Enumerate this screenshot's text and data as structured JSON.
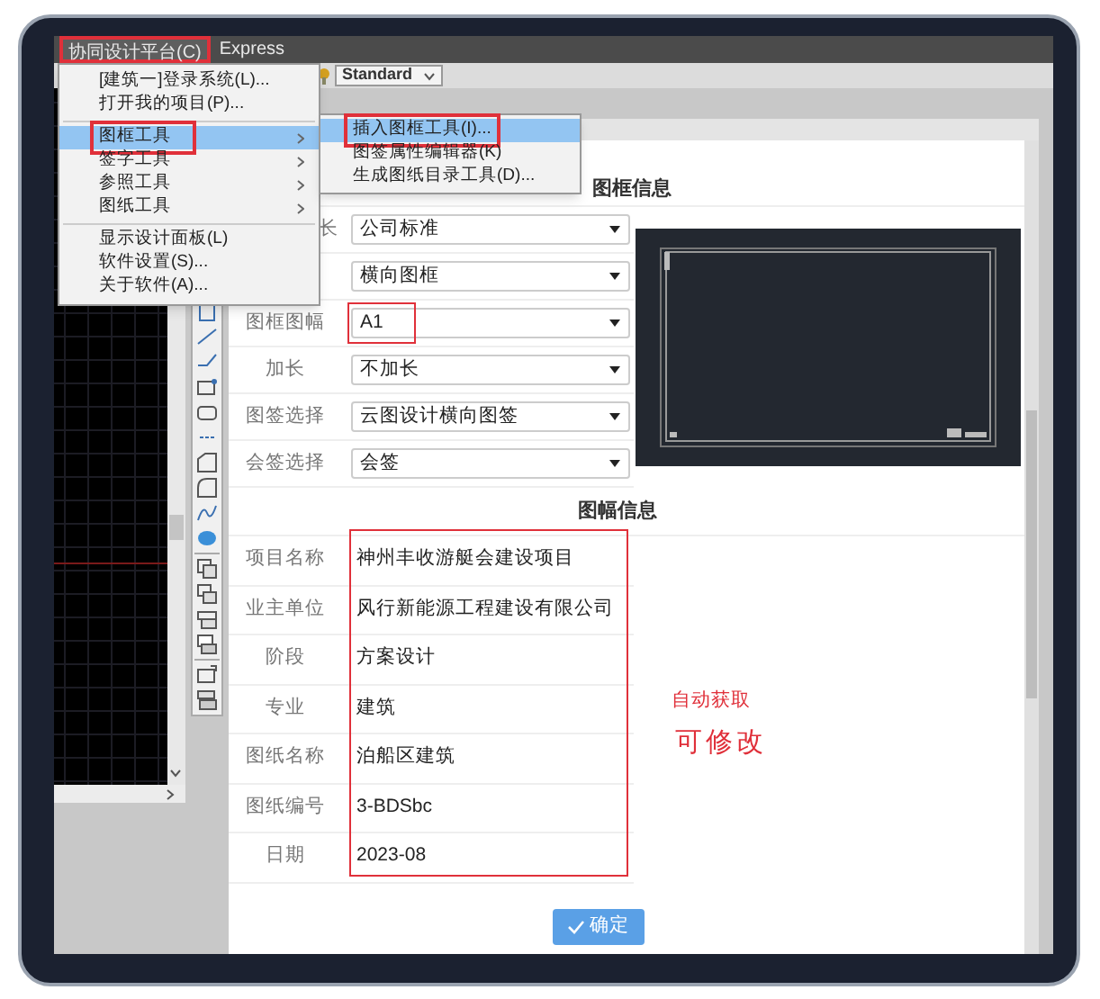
{
  "menubar": [
    {
      "label": "协同设计平台(C)",
      "highlighted": true
    },
    {
      "label": "Express",
      "highlighted": false
    }
  ],
  "toolbar": {
    "style_dropdown": "Standard"
  },
  "menu": [
    {
      "kind": "item",
      "label": "[建筑一]登录系统(L)...",
      "submenu": false,
      "selected": false,
      "highlighted": false
    },
    {
      "kind": "item",
      "label": "打开我的项目(P)...",
      "submenu": false,
      "selected": false,
      "highlighted": false
    },
    {
      "kind": "separator"
    },
    {
      "kind": "item",
      "label": "图框工具",
      "submenu": true,
      "selected": true,
      "highlighted": true
    },
    {
      "kind": "item",
      "label": "签字工具",
      "submenu": true,
      "selected": false,
      "highlighted": false
    },
    {
      "kind": "item",
      "label": "参照工具",
      "submenu": true,
      "selected": false,
      "highlighted": false
    },
    {
      "kind": "item",
      "label": "图纸工具",
      "submenu": true,
      "selected": false,
      "highlighted": false
    },
    {
      "kind": "separator"
    },
    {
      "kind": "item",
      "label": "显示设计面板(L)",
      "submenu": false,
      "selected": false,
      "highlighted": false
    },
    {
      "kind": "item",
      "label": "软件设置(S)...",
      "submenu": false,
      "selected": false,
      "highlighted": false
    },
    {
      "kind": "item",
      "label": "关于软件(A)...",
      "submenu": false,
      "selected": false,
      "highlighted": false
    }
  ],
  "submenu": [
    {
      "label": "插入图框工具(I)...",
      "selected": true,
      "highlighted": true
    },
    {
      "label": "图签属性编辑器(K)",
      "selected": false,
      "highlighted": false
    },
    {
      "label": "生成图纸目录工具(D)...",
      "selected": false,
      "highlighted": false
    }
  ],
  "frame_info": {
    "title": "图框信息",
    "rows": [
      {
        "label": "长",
        "label_clipped": true,
        "value": "公司标准",
        "highlighted": false
      },
      {
        "value": "横向图框",
        "highlighted": false
      },
      {
        "label": "图框图幅",
        "value": "A1",
        "highlighted": true
      },
      {
        "label": "加长",
        "value": "不加长",
        "highlighted": false
      },
      {
        "label": "图签选择",
        "value": "云图设计横向图签",
        "highlighted": false
      },
      {
        "label": "会签选择",
        "value": "会签",
        "highlighted": false
      }
    ]
  },
  "sheet_info": {
    "title": "图幅信息",
    "highlighted": true,
    "rows": [
      {
        "label": "项目名称",
        "value": "神州丰收游艇会建设项目"
      },
      {
        "label": "业主单位",
        "value": "风行新能源工程建设有限公司"
      },
      {
        "label": "阶段",
        "value": "方案设计"
      },
      {
        "label": "专业",
        "value": "建筑"
      },
      {
        "label": "图纸名称",
        "value": "泊船区建筑"
      },
      {
        "label": "图纸编号",
        "value": "3-BDSbc"
      },
      {
        "label": "日期",
        "value": "2023-08"
      }
    ]
  },
  "annotations": [
    {
      "label": "自动获取",
      "kind": "small"
    },
    {
      "label": "可修改",
      "kind": "large"
    }
  ],
  "confirm_button": "确定"
}
